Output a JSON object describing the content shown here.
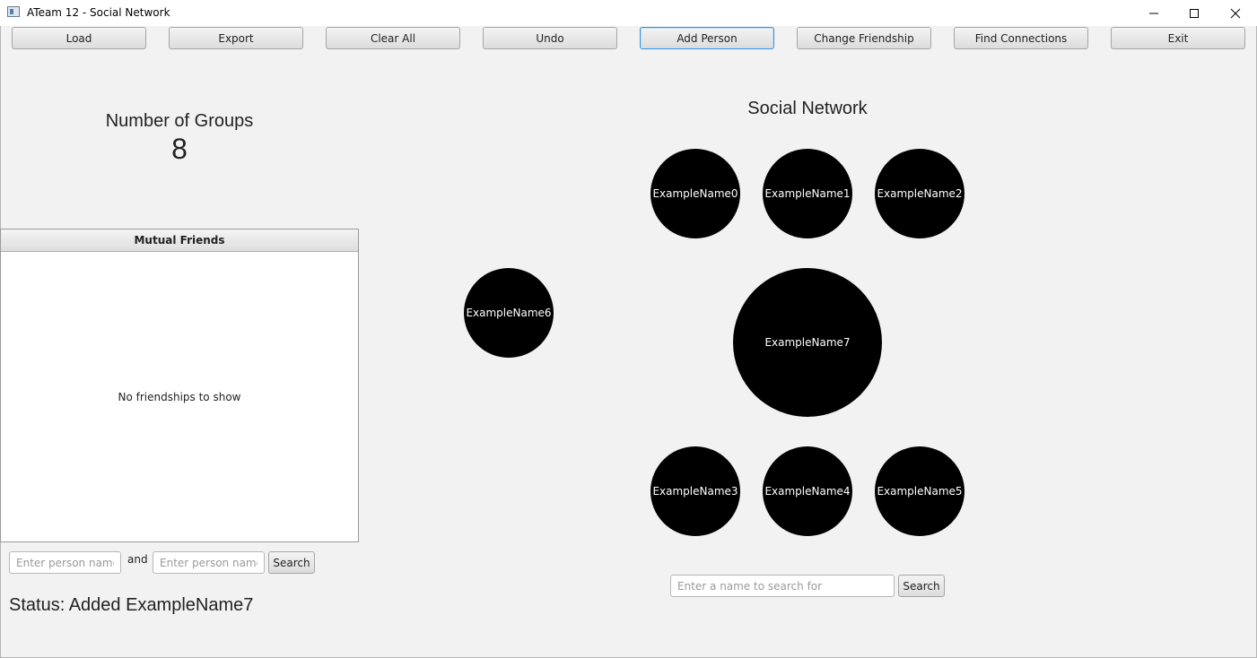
{
  "window": {
    "title": "ATeam 12 - Social Network"
  },
  "toolbar": [
    {
      "label": "Load"
    },
    {
      "label": "Export"
    },
    {
      "label": "Clear All"
    },
    {
      "label": "Undo"
    },
    {
      "label": "Add Person"
    },
    {
      "label": "Change Friendship"
    },
    {
      "label": "Find Connections"
    },
    {
      "label": "Exit"
    }
  ],
  "groups": {
    "label": "Number of Groups",
    "count": "8"
  },
  "mutual_friends": {
    "header": "Mutual Friends",
    "empty_message": "No friendships to show",
    "person1_placeholder": "Enter person name",
    "and_label": "and",
    "person2_placeholder": "Enter person name",
    "search_label": "Search"
  },
  "status": {
    "text": "Status: Added ExampleName7"
  },
  "network": {
    "title": "Social Network",
    "nodes": [
      {
        "name": "ExampleName0"
      },
      {
        "name": "ExampleName1"
      },
      {
        "name": "ExampleName2"
      },
      {
        "name": "ExampleName6"
      },
      {
        "name": "ExampleName7"
      },
      {
        "name": "ExampleName3"
      },
      {
        "name": "ExampleName4"
      },
      {
        "name": "ExampleName5"
      }
    ],
    "search_placeholder": "Enter a name to search for",
    "search_label": "Search"
  }
}
